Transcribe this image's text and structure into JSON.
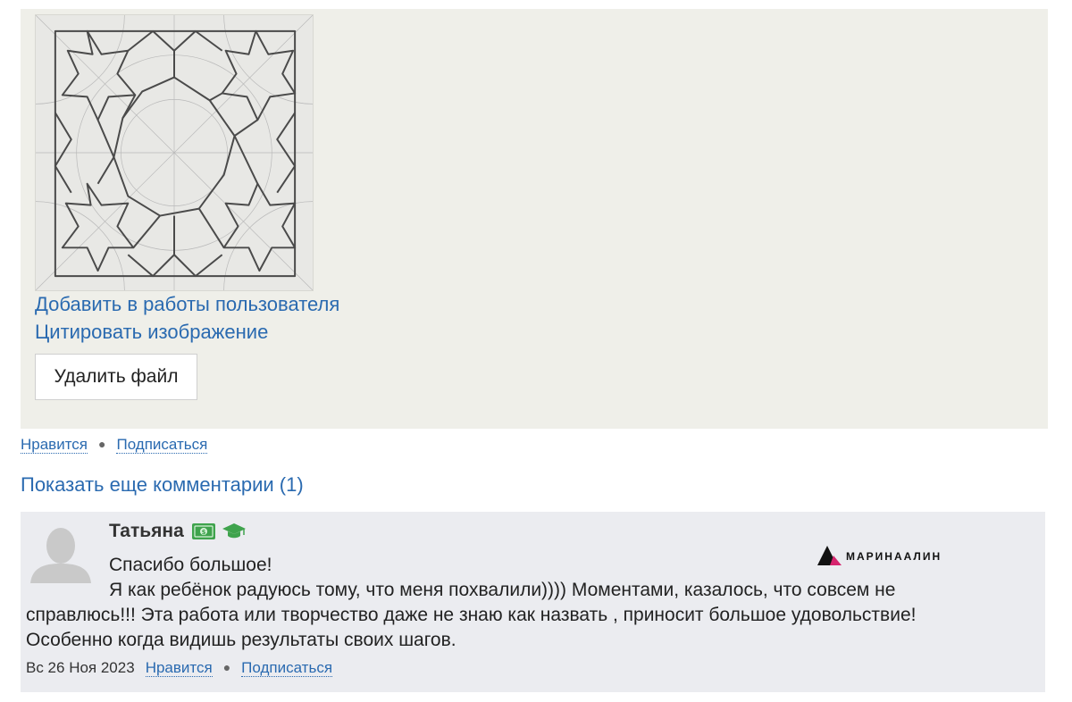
{
  "attachment": {
    "add_to_works_link": "Добавить в работы пользователя",
    "cite_image_link": "Цитировать изображение",
    "delete_button": "Удалить файл"
  },
  "post_actions": {
    "like": "Нравится",
    "subscribe": "Подписаться"
  },
  "show_more_comments": "Показать еще комментарии (1)",
  "comment": {
    "author": "Татьяна",
    "badges": [
      "money-badge-icon",
      "graduation-cap-icon"
    ],
    "watermark": "МАРИНААЛИН",
    "lines": [
      "Спасибо большое!",
      "Я как ребёнок радуюсь тому, что меня похвалили)))) Моментами, казалось, что совсем не",
      "справлюсь!!! Эта работа или творчество даже не знаю как назвать , приносит большое удовольствие!",
      "Особенно когда видишь результаты своих шагов."
    ],
    "date": "Вс 26 Ноя 2023",
    "like": "Нравится",
    "subscribe": "Подписаться"
  },
  "colors": {
    "link": "#2a6ab0",
    "panel_bg": "#efefe9",
    "comment_bg": "#ebecf0",
    "badge_green": "#3fa34d"
  }
}
